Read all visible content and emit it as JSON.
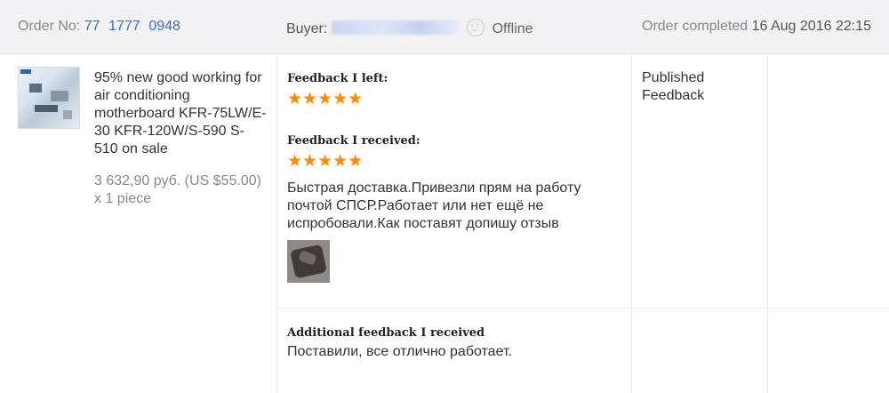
{
  "header": {
    "order_label": "Order No:",
    "order_number": "77   1777   0948",
    "buyer_label": "Buyer:",
    "buyer_status": "Offline",
    "completed_label": "Order completed",
    "completed_date": "16 Aug 2016 22:15"
  },
  "product": {
    "title": "95% new good working for air conditioning motherboard KFR-75LW/E-30 KFR-120W/S-590 S-510 on sale",
    "price": "3 632,90 руб. (US $55.00)",
    "quantity": "x 1 piece"
  },
  "feedback": {
    "left_label": "Feedback I left:",
    "left_stars": "★★★★★",
    "received_label": "Feedback I received:",
    "received_stars": "★★★★★",
    "received_text": "Быстрая доставка.Привезли прям на работу почтой СПСР.Работает или нет ещё не испробовали.Как поставят допишу отзыв",
    "additional_label": "Additional feedback I received",
    "additional_text": "Поставили, все отлично работает."
  },
  "status": {
    "published": "Published Feedback"
  },
  "colors": {
    "star": "#ff8a00",
    "link": "#3a6fbf",
    "header_bg": "#f2f2f4"
  }
}
